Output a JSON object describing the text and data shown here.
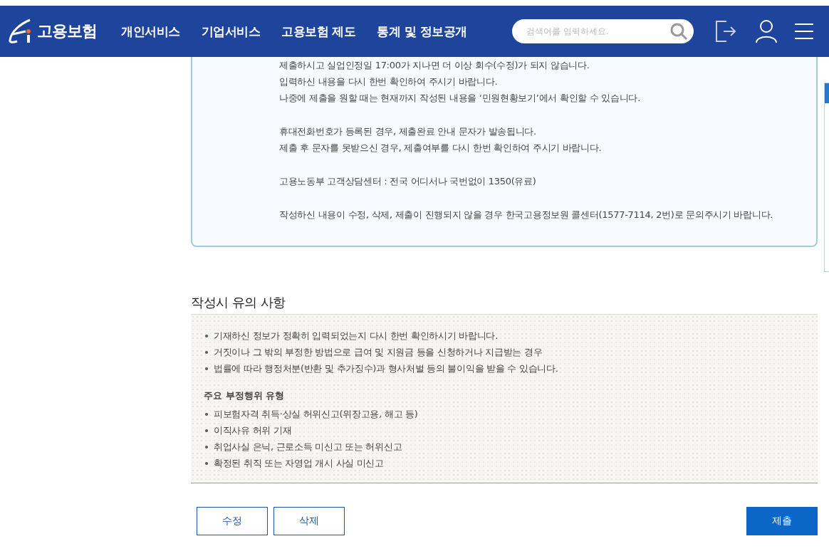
{
  "header": {
    "logo_text": "고용보험",
    "nav": [
      "개인서비스",
      "기업서비스",
      "고용보험 제도",
      "통계 및 정보공개"
    ],
    "search": {
      "placeholder": "검색어를 입력하세요."
    }
  },
  "notice": {
    "groups": [
      [
        "제출하시고 실업인정일 17:00가 지나면 더 이상 회수(수정)가 되지 않습니다.",
        "입력하신 내용을 다시 한번 확인하여 주시기 바랍니다.",
        "나중에 제출을 원할 때는 현재까지 작성된 내용을 ‘민원현황보기’에서 확인할 수 있습니다."
      ],
      [
        "휴대전화번호가 등록된 경우, 제출완료 안내 문자가 발송됩니다.",
        "제출 후 문자를 못받으신 경우, 제출여부를 다시 한번 확인하여 주시기 바랍니다."
      ],
      [
        "고용노동부 고객상담센터 : 전국 어디서나 국번없이 1350(유료)"
      ],
      [
        "작성하신 내용이 수정, 삭제, 제출이 진행되지 않을 경우 한국고용정보원 콜센터(1577-7114, 2번)로 문의주시기 바랍니다."
      ]
    ]
  },
  "cautions": {
    "title": "작성시 유의 사항",
    "bullets": [
      "기재하신 정보가 정확히 입력되었는지 다시 한번 확인하시기 바랍니다.",
      "거짓이나 그 밖의 부정한 방법으로 급여 및 지원금 등을 신청하거나 지급받는 경우",
      "법률에 따라 행정처분(반환 및 추가징수)과 형사처벌 등의 불이익을 받을 수 있습니다."
    ],
    "subheading": "주요 부정행위 유형",
    "types": [
      "피보험자격 취득·상실 허위신고(위장고용, 해고 등)",
      "이직사유 허위 기재",
      "취업사실 은닉, 근로소득 미신고 또는 허위신고",
      "확정된 취직 또는 자영업 개시 사실 미신고"
    ]
  },
  "buttons": [
    {
      "label": "수정",
      "kind": "outline"
    },
    {
      "label": "삭제",
      "kind": "outline"
    },
    {
      "label": "제출",
      "kind": "primary"
    }
  ]
}
